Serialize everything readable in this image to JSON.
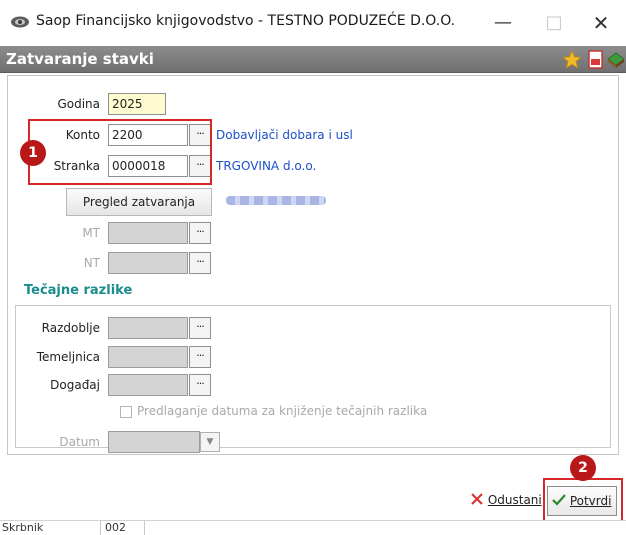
{
  "window": {
    "title": "Saop Financijsko knjigovodstvo - TESTNO PODUZEĆE D.O.O.",
    "minimize": "—",
    "maximize": "□",
    "close": "✕"
  },
  "header": {
    "title": "Zatvaranje stavki"
  },
  "form": {
    "godina": {
      "label": "Godina",
      "value": "2025"
    },
    "konto": {
      "label": "Konto",
      "value": "2200",
      "dots": "···",
      "description": "Dobavljači dobara i usl"
    },
    "stranka": {
      "label": "Stranka",
      "value": "0000018",
      "dots": "···",
      "description": "TRGOVINA d.o.o."
    },
    "pregled_button": "Pregled zatvaranja",
    "mt": {
      "label": "MT",
      "dots": "···"
    },
    "nt": {
      "label": "NT",
      "dots": "···"
    }
  },
  "tecajne": {
    "title": "Tečajne razlike",
    "razdoblje": {
      "label": "Razdoblje",
      "dots": "···"
    },
    "temeljnica": {
      "label": "Temeljnica",
      "dots": "···"
    },
    "dogadaj": {
      "label": "Događaj",
      "dots": "···"
    },
    "checkbox_label": "Predlaganje datuma za knjiženje tečajnih razlika",
    "datum": {
      "label": "Datum",
      "arrow": "▼"
    }
  },
  "buttons": {
    "odustani": "Odustani",
    "potvrdi": "Potvrdi"
  },
  "badges": {
    "one": "1",
    "two": "2"
  },
  "status": {
    "user_label": "Skrbnik",
    "user_value": "002"
  },
  "colors": {
    "highlight": "#d62828",
    "badge": "#b81818",
    "link": "#1c4fc9",
    "section": "#1a8c8c"
  }
}
